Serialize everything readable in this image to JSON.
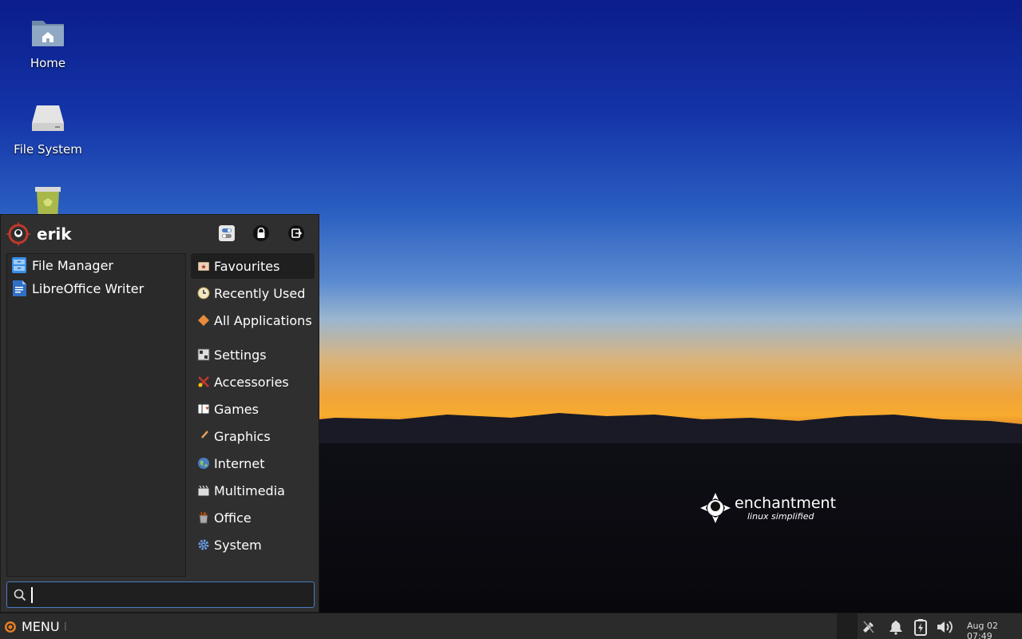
{
  "desktop": {
    "icons": [
      {
        "label": "Home"
      },
      {
        "label": "File System"
      },
      {
        "label": "Trash"
      }
    ],
    "branding": {
      "name": "enchantment",
      "tagline": "linux simplified"
    }
  },
  "menu": {
    "user": "erik",
    "header_buttons": [
      "settings-icon",
      "lock-icon",
      "logout-icon"
    ],
    "favourites": [
      {
        "label": "File Manager",
        "icon": "file-manager-icon"
      },
      {
        "label": "LibreOffice Writer",
        "icon": "writer-icon"
      }
    ],
    "categories": [
      {
        "label": "Favourites",
        "icon": "favourites-icon",
        "active": true
      },
      {
        "label": "Recently Used",
        "icon": "clock-icon"
      },
      {
        "label": "All Applications",
        "icon": "diamond-icon"
      },
      {
        "label": "Settings",
        "icon": "settings-icon"
      },
      {
        "label": "Accessories",
        "icon": "accessories-icon"
      },
      {
        "label": "Games",
        "icon": "cards-icon"
      },
      {
        "label": "Graphics",
        "icon": "brush-icon"
      },
      {
        "label": "Internet",
        "icon": "globe-icon"
      },
      {
        "label": "Multimedia",
        "icon": "clapper-icon"
      },
      {
        "label": "Office",
        "icon": "office-icon"
      },
      {
        "label": "System",
        "icon": "gear-icon"
      }
    ],
    "search": {
      "value": "",
      "placeholder": ""
    }
  },
  "taskbar": {
    "menu_label": "MENU",
    "clock": "Aug 02 07:49",
    "tray": [
      "network-icon",
      "bell-icon",
      "battery-icon",
      "volume-icon"
    ]
  },
  "colors": {
    "accent": "#4a7dbf",
    "panel": "#2f2f2f",
    "taskbar": "#2b2b2b"
  }
}
